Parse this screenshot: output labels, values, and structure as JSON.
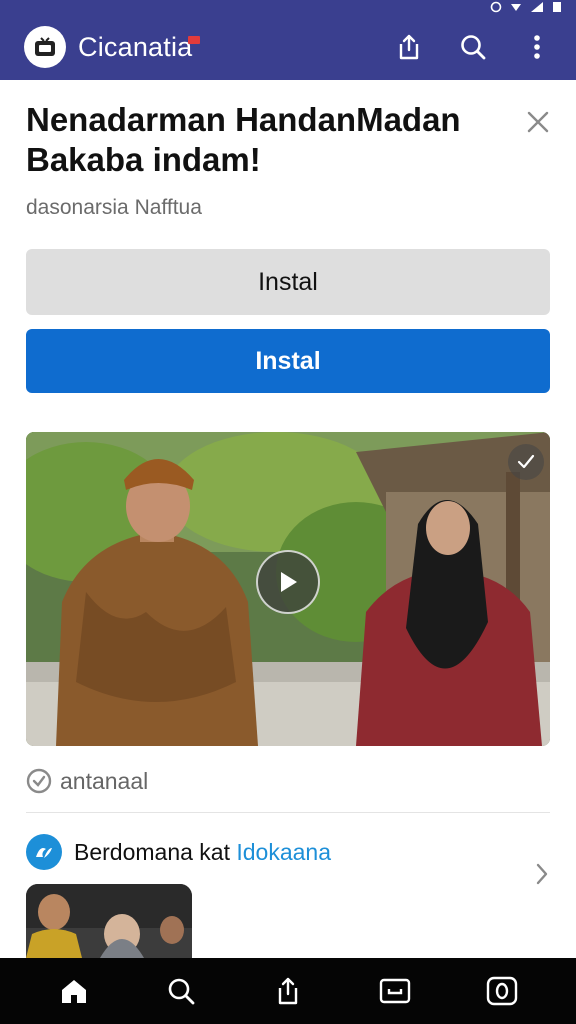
{
  "app": {
    "title": "Cicanatia",
    "accent_color": "#3a3f8f",
    "primary_button_color": "#0f6ccf"
  },
  "appbar": {
    "actions": [
      {
        "icon": "share-icon"
      },
      {
        "icon": "search-icon"
      },
      {
        "icon": "more-vert-icon"
      }
    ]
  },
  "banner": {
    "title": "Nenadarman HandanMadan Bakaba indam!",
    "subtitle": "dasonarsia Nafftua",
    "secondary_button_label": "Instal",
    "primary_button_label": "Instal"
  },
  "video": {
    "play_icon": "play-icon",
    "corner_icon": "check-icon"
  },
  "source": {
    "label": "antanaal",
    "icon": "verified-icon"
  },
  "recommend": {
    "prefix": "Berdomana kat ",
    "highlight": "Idokaana",
    "icon": "brand-icon",
    "chevron": "chevron-right-icon"
  },
  "bottom_nav": {
    "items": [
      {
        "icon": "home-icon"
      },
      {
        "icon": "search-icon"
      },
      {
        "icon": "share-icon"
      },
      {
        "icon": "inbox-icon"
      },
      {
        "icon": "profile-icon"
      }
    ]
  }
}
